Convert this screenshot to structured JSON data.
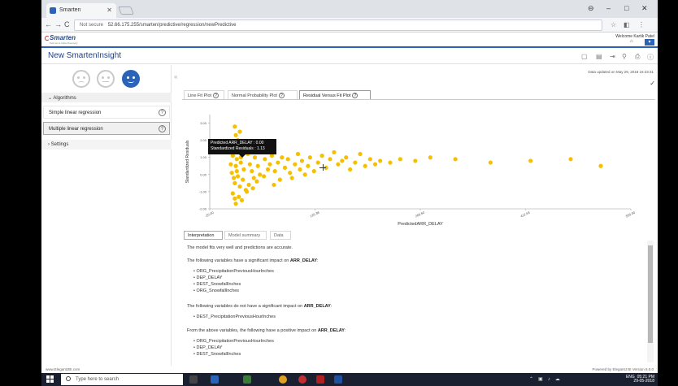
{
  "browser": {
    "tab_title": "Smarten",
    "url_security": "Not secure",
    "url": "52.66.175.255/smarten/predictive/regression/newPredictive",
    "minimize": "–",
    "maximize": "□",
    "close": "✕",
    "tab_close": "✕"
  },
  "header": {
    "logo_text": "Smarten",
    "logo_tagline": "Self-serve Data Discovery",
    "welcome": "Welcome Kartik Patel"
  },
  "titlebar": {
    "title": "New SmartenInsight"
  },
  "sidebar": {
    "algorithms_header": "Algorithms",
    "items": [
      {
        "label": "Simple linear regression",
        "help": "?"
      },
      {
        "label": "Multiple linear regression",
        "help": "?"
      }
    ],
    "settings_label": "Settings"
  },
  "main": {
    "updated_text": "Data updated on May 29, 2018 16:43:31",
    "chart_tabs": [
      {
        "label": "Line Fit Plot",
        "help": "?"
      },
      {
        "label": "Normal Probability Plot",
        "help": "?"
      },
      {
        "label": "Residual Versus Fit Plot",
        "help": "?"
      }
    ],
    "tooltip_line1": "Predicted ARR_DELAY : 0.00",
    "tooltip_line2": "Standardized Residuals : 1.13",
    "bottom_tabs": [
      "Interpretation",
      "Model summary",
      "Data"
    ],
    "interpretation": {
      "p1": "The model fits very well and predictions are accurate.",
      "p2_prefix": "The following variables have a significant impact on ",
      "p2_var": "ARR_DELAY",
      "list1": [
        "ORG_PrecipitationPreviousHourInches",
        "DEP_DELAY",
        "DEST_SnowfallInches",
        "ORG_SnowfallInches"
      ],
      "p3_prefix": "The following variables do not have a significant impact on ",
      "p3_var": "ARR_DELAY",
      "list2": [
        "DEST_PrecipitationPreviousHourInches"
      ],
      "p4_prefix": "From the above variables, the following have a positive impact on ",
      "p4_var": "ARR_DELAY",
      "list3": [
        "ORG_PrecipitationPreviousHourInches",
        "DEP_DELAY",
        "DEST_SnowfallInches"
      ]
    }
  },
  "footer": {
    "left": "www.ElegantJBI.com",
    "right": "Powered by ElegantJ BI Version 6.0.0"
  },
  "taskbar": {
    "search_placeholder": "Type here to search",
    "time": "05:21 PM",
    "date": "29-05-2018",
    "lang": "ENG"
  },
  "colors": {
    "accent": "#2a63b8",
    "point": "#f5c000"
  },
  "chart_data": {
    "type": "scatter",
    "title": "",
    "xlabel": "PredictedARR_DELAY",
    "ylabel": "Standardized Residuals",
    "xlim": [
      -20,
      400
    ],
    "ylim": [
      -2,
      3.5
    ],
    "x_ticks": [
      "-20.00",
      "126.38",
      "269.50",
      "412.63",
      "550.00"
    ],
    "y_ticks": [
      "3.00",
      "2.00",
      "1.00",
      "0.00",
      "-1.00",
      "-2.00"
    ],
    "points": [
      [
        5,
        2.8
      ],
      [
        6,
        2.3
      ],
      [
        10,
        2.5
      ],
      [
        8,
        2.0
      ],
      [
        12,
        1.8
      ],
      [
        4,
        1.6
      ],
      [
        9,
        1.4
      ],
      [
        15,
        1.3
      ],
      [
        3,
        1.1
      ],
      [
        7,
        0.9
      ],
      [
        11,
        0.7
      ],
      [
        6,
        0.5
      ],
      [
        14,
        0.3
      ],
      [
        2,
        0.1
      ],
      [
        8,
        -0.1
      ],
      [
        13,
        -0.3
      ],
      [
        5,
        -0.5
      ],
      [
        10,
        -0.7
      ],
      [
        16,
        -0.9
      ],
      [
        3,
        -1.1
      ],
      [
        9,
        -1.3
      ],
      [
        12,
        -1.5
      ],
      [
        6,
        -1.7
      ],
      [
        4,
        -0.2
      ],
      [
        7,
        0.2
      ],
      [
        11,
        1.0
      ],
      [
        14,
        1.5
      ],
      [
        18,
        1.2
      ],
      [
        20,
        0.6
      ],
      [
        22,
        0.2
      ],
      [
        24,
        -0.2
      ],
      [
        19,
        -0.6
      ],
      [
        17,
        -1.0
      ],
      [
        21,
        1.6
      ],
      [
        25,
        1.0
      ],
      [
        28,
        0.5
      ],
      [
        30,
        0.0
      ],
      [
        27,
        -0.4
      ],
      [
        23,
        -0.8
      ],
      [
        26,
        1.3
      ],
      [
        32,
        1.4
      ],
      [
        35,
        0.9
      ],
      [
        38,
        0.3
      ],
      [
        34,
        -0.1
      ],
      [
        40,
        0.6
      ],
      [
        42,
        1.1
      ],
      [
        45,
        0.2
      ],
      [
        48,
        0.7
      ],
      [
        50,
        -0.3
      ],
      [
        44,
        -0.6
      ],
      [
        52,
        1.0
      ],
      [
        55,
        0.4
      ],
      [
        58,
        0.9
      ],
      [
        60,
        0.1
      ],
      [
        62,
        -0.2
      ],
      [
        65,
        0.6
      ],
      [
        68,
        1.2
      ],
      [
        70,
        0.3
      ],
      [
        72,
        0.8
      ],
      [
        75,
        0.0
      ],
      [
        78,
        0.5
      ],
      [
        80,
        1.0
      ],
      [
        84,
        0.2
      ],
      [
        88,
        0.7
      ],
      [
        92,
        1.1
      ],
      [
        96,
        0.4
      ],
      [
        100,
        0.9
      ],
      [
        104,
        1.3
      ],
      [
        108,
        0.6
      ],
      [
        112,
        0.8
      ],
      [
        116,
        1.0
      ],
      [
        120,
        0.3
      ],
      [
        125,
        0.7
      ],
      [
        130,
        1.2
      ],
      [
        135,
        0.5
      ],
      [
        140,
        0.9
      ],
      [
        145,
        0.6
      ],
      [
        150,
        0.8
      ],
      [
        160,
        0.7
      ],
      [
        170,
        0.9
      ],
      [
        185,
        0.8
      ],
      [
        200,
        1.0
      ],
      [
        225,
        0.9
      ],
      [
        260,
        0.7
      ],
      [
        300,
        0.8
      ],
      [
        340,
        0.9
      ],
      [
        370,
        0.5
      ],
      [
        1,
        0.6
      ],
      [
        2,
        1.9
      ],
      [
        5,
        -1.4
      ]
    ]
  }
}
